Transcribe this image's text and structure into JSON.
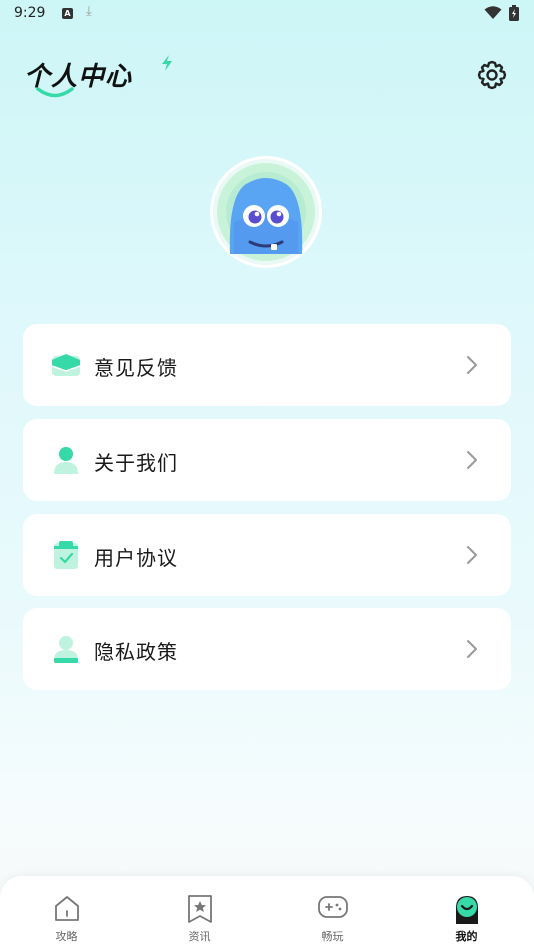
{
  "status_bar": {
    "time": "9:29",
    "notif_a": "A"
  },
  "header": {
    "title": "个人中心"
  },
  "menu": {
    "items": [
      {
        "label": "意见反馈",
        "icon": "feedback-icon"
      },
      {
        "label": "关于我们",
        "icon": "person-icon"
      },
      {
        "label": "用户协议",
        "icon": "clipboard-check-icon"
      },
      {
        "label": "隐私政策",
        "icon": "profile-card-icon"
      }
    ]
  },
  "tabbar": {
    "tabs": [
      {
        "label": "攻略",
        "icon": "home-icon",
        "active": false
      },
      {
        "label": "资讯",
        "icon": "star-bookmark-icon",
        "active": false
      },
      {
        "label": "畅玩",
        "icon": "gamepad-icon",
        "active": false
      },
      {
        "label": "我的",
        "icon": "smile-face-icon",
        "active": true
      }
    ]
  },
  "colors": {
    "accent": "#36d9a8",
    "accent_light": "#bff3e0",
    "text": "#1a1a1a"
  }
}
